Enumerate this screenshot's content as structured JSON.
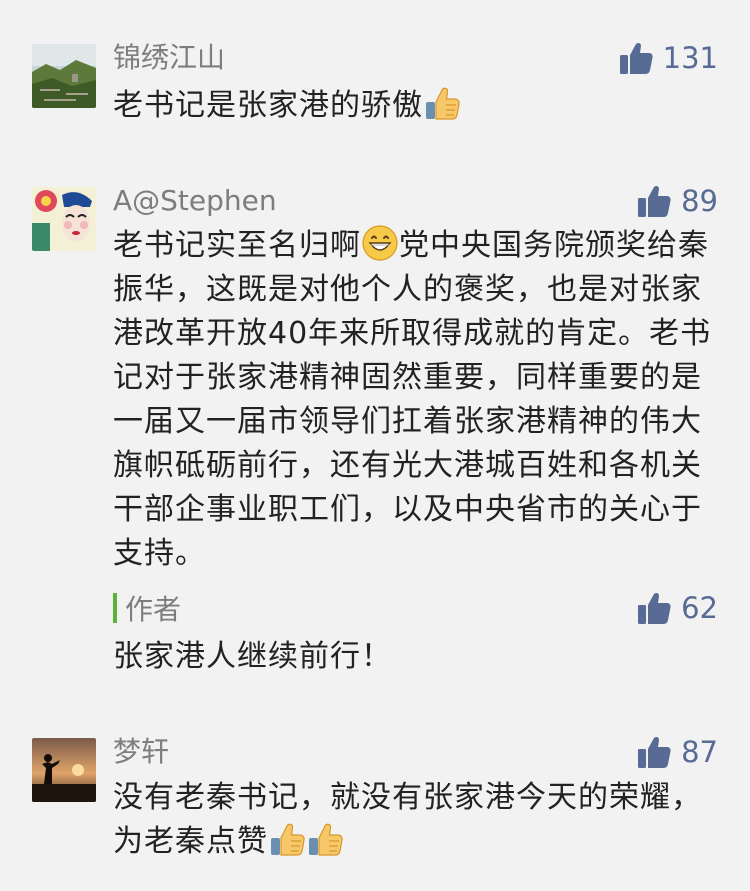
{
  "comments": [
    {
      "nickname": "锦绣江山",
      "likes": "131",
      "text": "老书记是张家港的骄傲",
      "trailing_emoji": "thumbs-up"
    },
    {
      "nickname": "A@Stephen",
      "likes": "89",
      "text_before_emoji": "老书记实至名归啊",
      "text_after_emoji": "党中央国务院颁奖给秦振华，这既是对他个人的褒奖，也是对张家港改革开放40年来所取得成就的肯定。老书记对于张家港精神固然重要，同样重要的是一届又一届市领导们扛着张家港精神的伟大旗帜砥砺前行，还有光大港城百姓和各机关干部企事业职工们，以及中央省市的关心于支持。",
      "inline_emoji": "grinning-face",
      "reply": {
        "label": "作者",
        "likes": "62",
        "text": "张家港人继续前行！"
      }
    },
    {
      "nickname": "梦轩",
      "likes": "87",
      "text": "没有老秦书记，就没有张家港今天的荣耀，为老秦点赞",
      "trailing_emoji": "thumbs-up-x2"
    }
  ],
  "colors": {
    "background": "#f2f2f2",
    "nickname": "#7d7d7d",
    "like_count": "#576b95",
    "author_bar": "#5ab43c"
  }
}
